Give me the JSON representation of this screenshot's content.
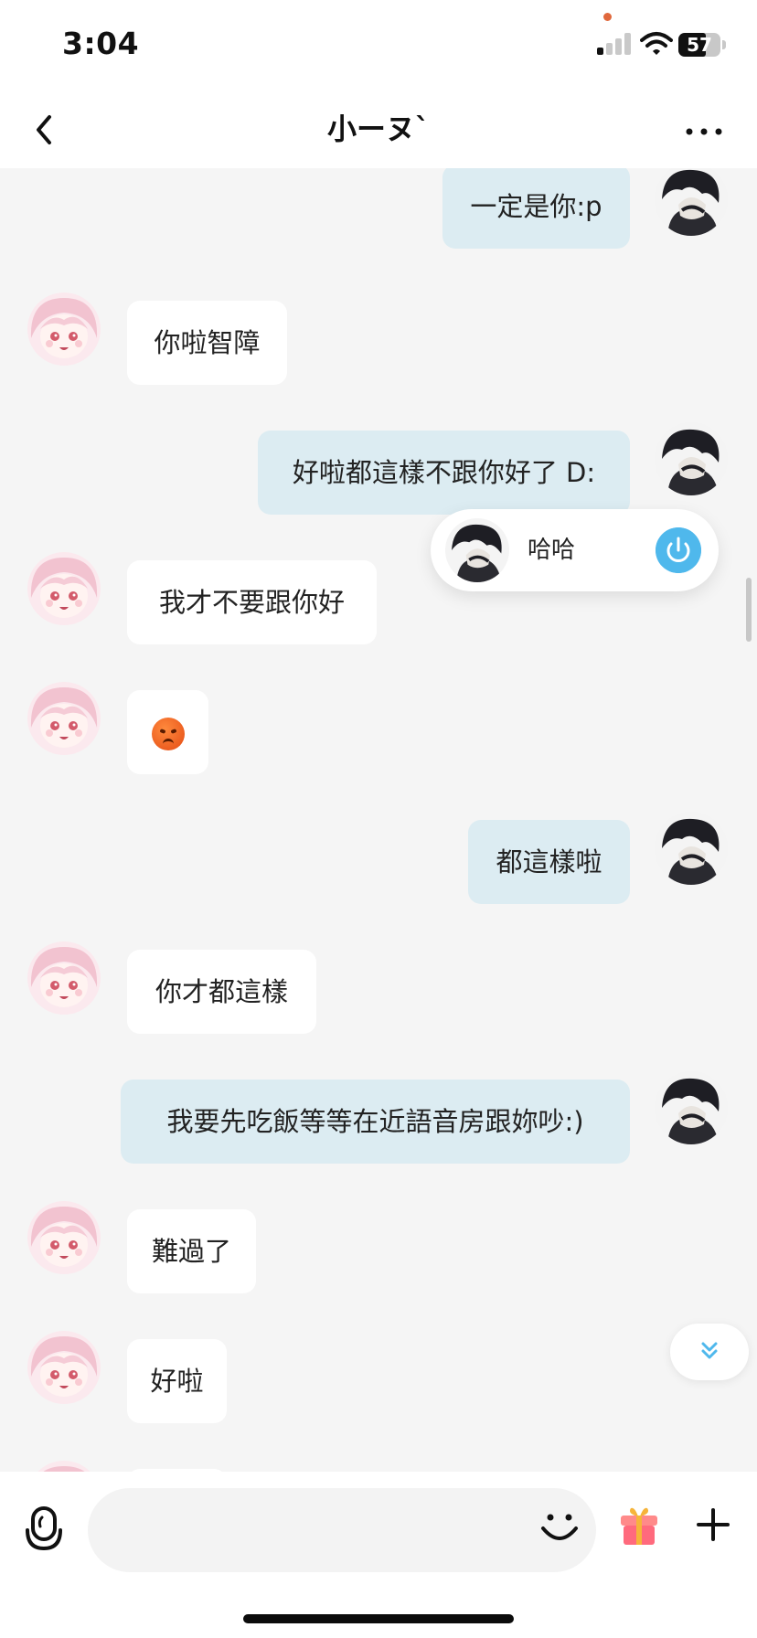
{
  "status_bar": {
    "time": "3:04",
    "battery": "57"
  },
  "header": {
    "title": "小ーヌ`"
  },
  "messages": [
    {
      "sender": "me",
      "text": "一定是你:p"
    },
    {
      "sender": "them",
      "text": "你啦智障"
    },
    {
      "sender": "me",
      "text": "好啦都這樣不跟你好了 D:"
    },
    {
      "sender": "them",
      "text": "我才不要跟你好"
    },
    {
      "sender": "them",
      "text": "",
      "emoji": "angry-face"
    },
    {
      "sender": "me",
      "text": "都這樣啦"
    },
    {
      "sender": "them",
      "text": "你才都這樣"
    },
    {
      "sender": "me",
      "text": "我要先吃飯等等在近語音房跟妳吵:)"
    },
    {
      "sender": "them",
      "text": "難過了"
    },
    {
      "sender": "them",
      "text": "好啦"
    }
  ],
  "voice_room": {
    "label": "哈哈"
  },
  "colors": {
    "my_bubble": "#dcecf2",
    "their_bubble": "#ffffff",
    "accent": "#4fb8ec",
    "gift": "#ff6a7d"
  },
  "icons": [
    "back-chevron-icon",
    "more-dots-icon",
    "microphone-icon",
    "smile-icon",
    "gift-icon",
    "plus-icon",
    "double-chevron-down-icon",
    "power-icon"
  ]
}
